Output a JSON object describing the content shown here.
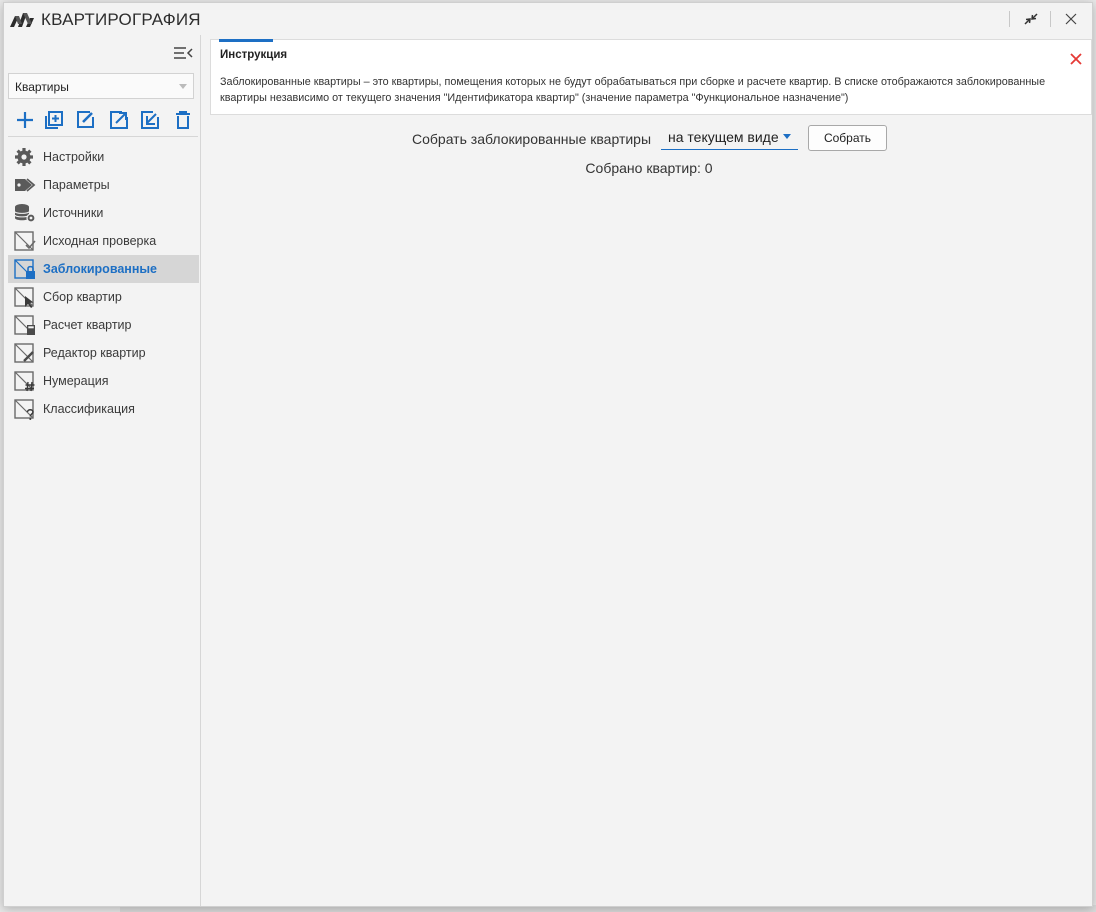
{
  "app": {
    "title": "КВАРТИРОГРАФИЯ"
  },
  "sidebar": {
    "selector_value": "Квартиры",
    "toolbar": [
      "add-icon",
      "add-copy-icon",
      "edit-icon",
      "export-icon",
      "import-icon",
      "delete-icon"
    ],
    "items": [
      {
        "label": "Настройки",
        "icon": "gear-icon"
      },
      {
        "label": "Параметры",
        "icon": "tag-icon"
      },
      {
        "label": "Источники",
        "icon": "database-icon"
      },
      {
        "label": "Исходная проверка",
        "icon": "room-check-icon"
      },
      {
        "label": "Заблокированные",
        "icon": "room-lock-icon",
        "active": true
      },
      {
        "label": "Сбор квартир",
        "icon": "room-collect-icon"
      },
      {
        "label": "Расчет квартир",
        "icon": "room-calc-icon"
      },
      {
        "label": "Редактор квартир",
        "icon": "room-edit-icon"
      },
      {
        "label": "Нумерация",
        "icon": "room-number-icon"
      },
      {
        "label": "Классификация",
        "icon": "room-classify-icon"
      }
    ]
  },
  "info": {
    "title": "Инструкция",
    "text": "Заблокированные квартиры – это квартиры, помещения которых не будут обрабатываться при сборке и расчете квартир. В списке отображаются заблокированные квартиры независимо от текущего значения \"Идентификатора квартир\" (значение параметра \"Функциональное назначение\")"
  },
  "collect": {
    "label": "Собрать заблокированные квартиры",
    "scope_value": "на текущем виде",
    "button_label": "Собрать",
    "result_text": "Собрано квартир: 0"
  },
  "colors": {
    "accent": "#1d6fc4",
    "close": "#e53935",
    "active_bg": "#d6d6d6"
  }
}
